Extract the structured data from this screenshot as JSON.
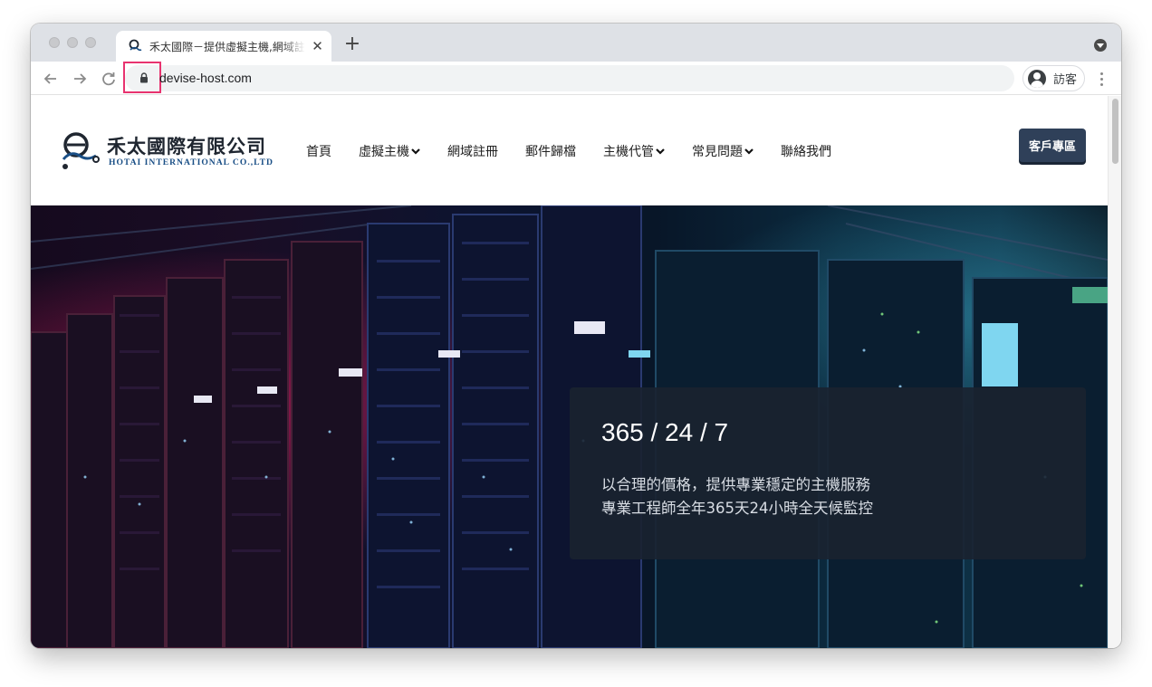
{
  "browser": {
    "tab_title": "禾太國際－提供虛擬主機,網域註冊",
    "url": "devise-host.com",
    "profile_label": "訪客"
  },
  "site": {
    "logo_text_cn": "禾太國際有限公司",
    "logo_text_en": "HOTAI INTERNATIONAL CO.,LTD",
    "nav": [
      {
        "label": "首頁",
        "dropdown": false
      },
      {
        "label": "虛擬主機",
        "dropdown": true
      },
      {
        "label": "網域註冊",
        "dropdown": false
      },
      {
        "label": "郵件歸檔",
        "dropdown": false
      },
      {
        "label": "主機代管",
        "dropdown": true
      },
      {
        "label": "常見問題",
        "dropdown": true
      },
      {
        "label": "聯絡我們",
        "dropdown": false
      }
    ],
    "client_button": "客戶專區"
  },
  "hero": {
    "title": "365 / 24 / 7",
    "line1": "以合理的價格，提供專業穩定的主機服務",
    "line2": "專業工程師全年365天24小時全天候監控"
  },
  "colors": {
    "accent_dark": "#2f4059",
    "highlight": "#e8336f"
  }
}
